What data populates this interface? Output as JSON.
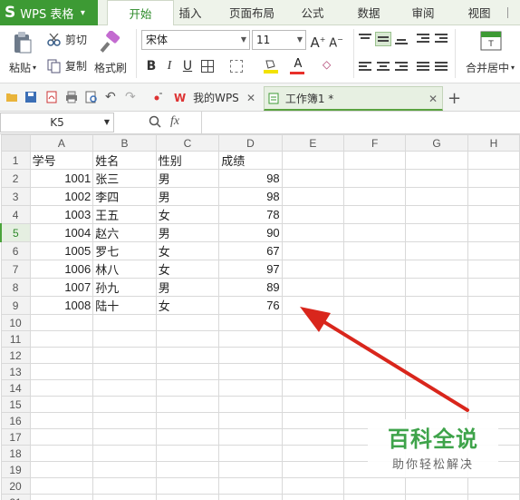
{
  "app": {
    "logo": "S",
    "title": "WPS 表格",
    "menu_arrow": "▾"
  },
  "menu_tabs": [
    "开始",
    "插入",
    "页面布局",
    "公式",
    "数据",
    "审阅",
    "视图"
  ],
  "ribbon": {
    "paste": "粘贴",
    "cut": "剪切",
    "copy": "复制",
    "format_painter": "格式刷",
    "font_name": "宋体",
    "font_size": "11",
    "bold": "B",
    "italic": "I",
    "underline": "U",
    "merge_center": "合并居中"
  },
  "doc_tabs": {
    "home": "我的WPS",
    "workbook": "工作簿1 *",
    "add": "+"
  },
  "formula_bar": {
    "cell_ref": "K5",
    "fx": "fx"
  },
  "sheet": {
    "columns": [
      "A",
      "B",
      "C",
      "D",
      "E",
      "F",
      "G",
      "H"
    ],
    "selected_row": 5,
    "rows": [
      [
        "学号",
        "姓名",
        "性别",
        "成绩"
      ],
      [
        "1001",
        "张三",
        "男",
        "98"
      ],
      [
        "1002",
        "李四",
        "男",
        "98"
      ],
      [
        "1003",
        "王五",
        "女",
        "78"
      ],
      [
        "1004",
        "赵六",
        "男",
        "90"
      ],
      [
        "1005",
        "罗七",
        "女",
        "67"
      ],
      [
        "1006",
        "林八",
        "女",
        "97"
      ],
      [
        "1007",
        "孙九",
        "男",
        "89"
      ],
      [
        "1008",
        "陆十",
        "女",
        "76"
      ],
      [],
      [],
      [],
      [],
      [],
      [],
      [],
      [],
      [],
      [],
      [],
      []
    ]
  },
  "watermark": {
    "main": "百科全说",
    "sub": "助你轻松解决"
  },
  "colors": {
    "accent": "#3d9a34",
    "annotation_arrow": "#d9261c",
    "watermark": "#3ea34a"
  }
}
